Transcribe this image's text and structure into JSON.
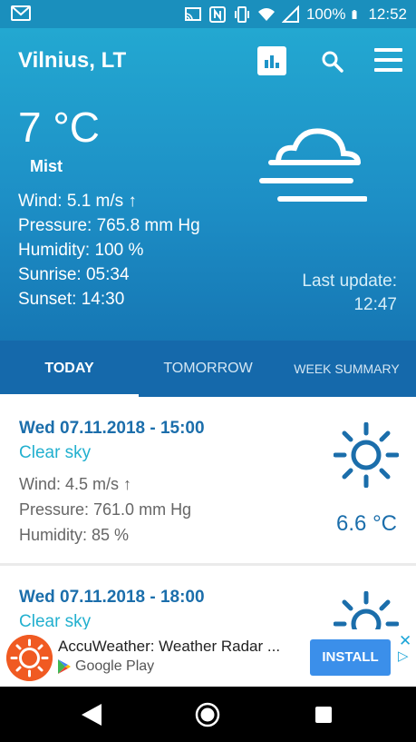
{
  "status_bar": {
    "battery": "100%",
    "time": "12:52"
  },
  "header": {
    "city": "Vilnius, LT",
    "icons": [
      "chart-icon",
      "search-icon",
      "menu-icon"
    ]
  },
  "current": {
    "temperature": "7 °C",
    "condition": "Mist",
    "wind": "Wind: 5.1 m/s ↑",
    "pressure": "Pressure: 765.8 mm Hg",
    "humidity": "Humidity: 100 %",
    "sunrise": "Sunrise: 05:34",
    "sunset": "Sunset: 14:30",
    "last_update_label": "Last update:",
    "last_update_time": "12:47",
    "icon": "mist-icon"
  },
  "tabs": [
    {
      "label": "TODAY",
      "active": true
    },
    {
      "label": "TOMORROW",
      "active": false
    },
    {
      "label": "WEEK SUMMARY",
      "active": false
    }
  ],
  "forecast": [
    {
      "date": "Wed 07.11.2018 - 15:00",
      "description": "Clear sky",
      "wind": "Wind: 4.5 m/s ↑",
      "pressure": "Pressure: 761.0 mm Hg",
      "humidity": "Humidity: 85 %",
      "temperature": "6.6 °C",
      "icon": "sun-icon"
    },
    {
      "date": "Wed 07.11.2018 - 18:00",
      "description": "Clear sky",
      "icon": "sun-icon"
    }
  ],
  "ad": {
    "title": "AccuWeather: Weather Radar ...",
    "store": "Google Play",
    "install_label": "INSTALL"
  },
  "colors": {
    "header_top": "#23a8d1",
    "header_bottom": "#1677b4",
    "tab_bar": "#1569ab",
    "date_text": "#1b6eab",
    "sky_text": "#22b0cf",
    "install_button": "#3b8fea",
    "ad_logo": "#f05a22"
  }
}
